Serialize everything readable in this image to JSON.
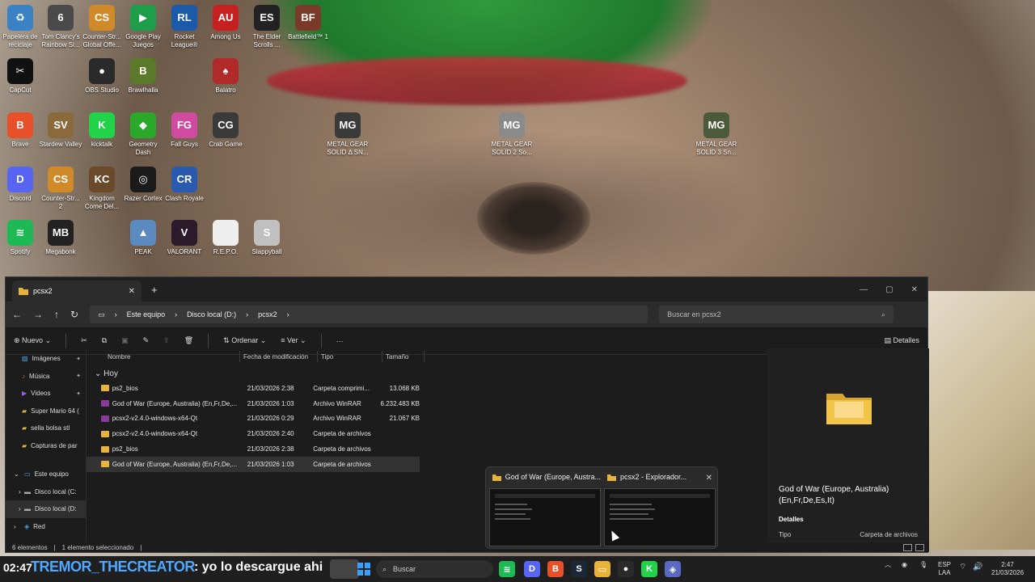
{
  "desktop": {
    "icons": [
      {
        "label": "Papelera de reciclaje",
        "icon": "recycle-bin-icon",
        "color": "#3b82c4",
        "glyph": "♻"
      },
      {
        "label": "Tom Clancy's Rainbow Si...",
        "icon": "rainbow-six-icon",
        "color": "#4a4a4a",
        "glyph": "6"
      },
      {
        "label": "Counter-Str... Global Offe...",
        "icon": "csgo-icon",
        "color": "#d08a2a",
        "glyph": "CS"
      },
      {
        "label": "Google Play Juegos",
        "icon": "google-play-games-icon",
        "color": "#1e9e4a",
        "glyph": "▶"
      },
      {
        "label": "Rocket League®",
        "icon": "rocket-league-icon",
        "color": "#1a5aa8",
        "glyph": "RL"
      },
      {
        "label": "Among Us",
        "icon": "among-us-icon",
        "color": "#c72020",
        "glyph": "AU"
      },
      {
        "label": "The Elder Scrolls ...",
        "icon": "elder-scrolls-icon",
        "color": "#222222",
        "glyph": "ES"
      },
      {
        "label": "Battlefield™ 1",
        "icon": "battlefield-icon",
        "color": "#7a3a2a",
        "glyph": "BF"
      },
      {
        "label": "CapCut",
        "icon": "capcut-icon",
        "color": "#111111",
        "glyph": "✂"
      },
      {
        "label": "OBS Studio",
        "icon": "obs-icon",
        "color": "#2a2a2a",
        "glyph": "●"
      },
      {
        "label": "Brawlhalla",
        "icon": "brawlhalla-icon",
        "color": "#5a7a2a",
        "glyph": "B"
      },
      {
        "label": "Balatro",
        "icon": "balatro-icon",
        "color": "#b02a2a",
        "glyph": "♠"
      },
      {
        "label": "Brave",
        "icon": "brave-icon",
        "color": "#e8502a",
        "glyph": "B"
      },
      {
        "label": "Stardew Valley",
        "icon": "stardew-valley-icon",
        "color": "#8a6a3a",
        "glyph": "SV"
      },
      {
        "label": "kicktalk",
        "icon": "kicktalk-icon",
        "color": "#22d34a",
        "glyph": "K"
      },
      {
        "label": "Geometry Dash",
        "icon": "geometry-dash-icon",
        "color": "#2aa82a",
        "glyph": "◆"
      },
      {
        "label": "Fall Guys",
        "icon": "fall-guys-icon",
        "color": "#d04aa0",
        "glyph": "FG"
      },
      {
        "label": "Crab Game",
        "icon": "crab-game-icon",
        "color": "#3a3a3a",
        "glyph": "CG"
      },
      {
        "label": "METAL GEAR SOLID Δ SN...",
        "icon": "metal-gear-delta-icon",
        "color": "#3a3a3a",
        "glyph": "MG"
      },
      {
        "label": "METAL GEAR SOLID 2 So...",
        "icon": "metal-gear-2-icon",
        "color": "#8a8a8a",
        "glyph": "MG"
      },
      {
        "label": "METAL GEAR SOLID 3 Sn...",
        "icon": "metal-gear-3-icon",
        "color": "#4a5a3a",
        "glyph": "MG"
      },
      {
        "label": "Discord",
        "icon": "discord-icon",
        "color": "#5865f2",
        "glyph": "D"
      },
      {
        "label": "Counter-Str... 2",
        "icon": "cs2-icon",
        "color": "#d08a2a",
        "glyph": "CS"
      },
      {
        "label": "Kingdom Come Del...",
        "icon": "kingdom-come-icon",
        "color": "#6a4a2a",
        "glyph": "KC"
      },
      {
        "label": "Razer Cortex",
        "icon": "razer-cortex-icon",
        "color": "#1a1a1a",
        "glyph": "◎"
      },
      {
        "label": "Clash Royale",
        "icon": "clash-royale-icon",
        "color": "#2a5ab0",
        "glyph": "CR"
      },
      {
        "label": "Spotify",
        "icon": "spotify-icon",
        "color": "#1db954",
        "glyph": "≋"
      },
      {
        "label": "Megabonk",
        "icon": "megabonk-icon",
        "color": "#222222",
        "glyph": "MB"
      },
      {
        "label": "PEAK",
        "icon": "peak-icon",
        "color": "#5a8ac0",
        "glyph": "▲"
      },
      {
        "label": "VALORANT",
        "icon": "valorant-icon",
        "color": "#2a1a2a",
        "glyph": "V"
      },
      {
        "label": "R.E.P.O.",
        "icon": "repo-icon",
        "color": "#eeeeee",
        "glyph": ""
      },
      {
        "label": "Slappyball",
        "icon": "slappyball-icon",
        "color": "#c0c0c0",
        "glyph": "S"
      }
    ]
  },
  "explorer": {
    "tab_title": "pcsx2",
    "new_tab": "+",
    "breadcrumb": [
      "Este equipo",
      "Disco local (D:)",
      "pcsx2"
    ],
    "search_placeholder": "Buscar en pcsx2",
    "toolbar": {
      "new": "Nuevo",
      "sort": "Ordenar",
      "view": "Ver",
      "more": "···",
      "details": "Detalles"
    },
    "nav_items": [
      {
        "label": "Imágenes",
        "icon": "images-icon",
        "pinned": true
      },
      {
        "label": "Música",
        "icon": "music-icon",
        "pinned": true
      },
      {
        "label": "Videos",
        "icon": "videos-icon",
        "pinned": true
      },
      {
        "label": "Super Mario 64 (",
        "icon": "folder-icon",
        "pinned": false
      },
      {
        "label": "sella bolsa stl",
        "icon": "folder-icon",
        "pinned": false
      },
      {
        "label": "Capturas de par",
        "icon": "folder-icon",
        "pinned": false
      }
    ],
    "tree": [
      {
        "label": "Este equipo",
        "icon": "this-pc-icon",
        "expand": "⌄"
      },
      {
        "label": "Disco local (C:",
        "icon": "drive-icon",
        "expand": "›"
      },
      {
        "label": "Disco local (D:",
        "icon": "drive-icon",
        "expand": "›"
      },
      {
        "label": "Red",
        "icon": "network-icon",
        "expand": "›"
      }
    ],
    "columns": {
      "name": "Nombre",
      "date": "Fecha de modificación",
      "type": "Tipo",
      "size": "Tamaño"
    },
    "group_label": "Hoy",
    "files": [
      {
        "name": "ps2_bios",
        "date": "21/03/2026 2:38",
        "type": "Carpeta comprimi...",
        "size": "13.068 KB",
        "icon": "zip-folder-icon",
        "selected": false
      },
      {
        "name": "God of War (Europe, Australia) (En,Fr,De,...",
        "date": "21/03/2026 1:03",
        "type": "Archivo WinRAR",
        "size": "6.232.483 KB",
        "icon": "winrar-icon",
        "selected": false
      },
      {
        "name": "pcsx2-v2.4.0-windows-x64-Qt",
        "date": "21/03/2026 0:29",
        "type": "Archivo WinRAR",
        "size": "21.067 KB",
        "icon": "winrar-icon",
        "selected": false
      },
      {
        "name": "pcsx2-v2.4.0-windows-x64-Qt",
        "date": "21/03/2026 2:40",
        "type": "Carpeta de archivos",
        "size": "",
        "icon": "folder-icon",
        "selected": false
      },
      {
        "name": "ps2_bios",
        "date": "21/03/2026 2:38",
        "type": "Carpeta de archivos",
        "size": "",
        "icon": "folder-icon",
        "selected": false
      },
      {
        "name": "God of War (Europe, Australia) (En,Fr,De,...",
        "date": "21/03/2026 1:03",
        "type": "Carpeta de archivos",
        "size": "",
        "icon": "folder-icon",
        "selected": true
      }
    ],
    "details_pane": {
      "title": "God of War (Europe, Australia) (En,Fr,De,Es,It)",
      "section": "Detalles",
      "key": "Tipo",
      "value": "Carpeta de archivos"
    },
    "status": {
      "count": "6 elementos",
      "selected": "1 elemento seleccionado"
    }
  },
  "previews": [
    {
      "title": "God of War (Europe, Austra..."
    },
    {
      "title": "pcsx2 - Explorador..."
    }
  ],
  "overlay": {
    "time": "02:47",
    "user": "TREMOR_THECREATOR",
    "message": ": yo lo descargue ahi"
  },
  "taskbar": {
    "search": "Buscar",
    "lang": "ESP",
    "layout": "LAA",
    "clock": "2:47",
    "date": "21/03/2026",
    "apps": [
      {
        "icon": "spotify-icon",
        "color": "#1db954",
        "glyph": "≋"
      },
      {
        "icon": "discord-icon",
        "color": "#5865f2",
        "glyph": "D"
      },
      {
        "icon": "brave-icon",
        "color": "#e8502a",
        "glyph": "B"
      },
      {
        "icon": "steam-icon",
        "color": "#1b2838",
        "glyph": "S"
      },
      {
        "icon": "file-explorer-icon",
        "color": "#e8b33a",
        "glyph": "▭"
      },
      {
        "icon": "obs-icon",
        "color": "#2a2a2a",
        "glyph": "●"
      },
      {
        "icon": "kick-icon",
        "color": "#22d34a",
        "glyph": "K"
      },
      {
        "icon": "app-icon",
        "color": "#5a6ac0",
        "glyph": "◈"
      }
    ]
  }
}
